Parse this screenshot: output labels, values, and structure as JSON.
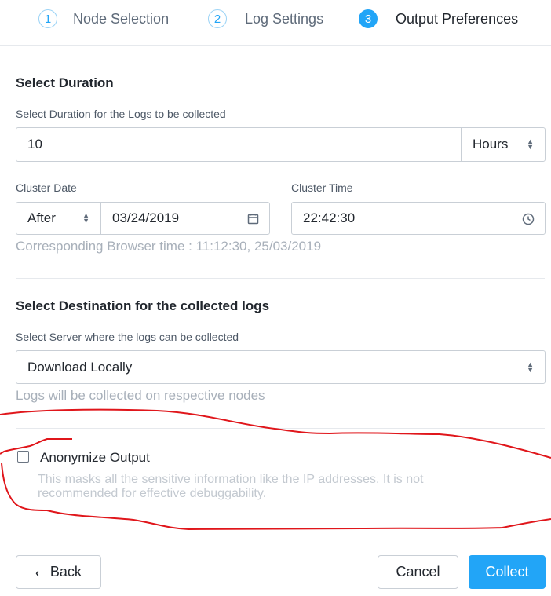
{
  "stepper": {
    "steps": [
      {
        "num": "1",
        "label": "Node Selection"
      },
      {
        "num": "2",
        "label": "Log Settings"
      },
      {
        "num": "3",
        "label": "Output Preferences"
      }
    ],
    "active_step": "3"
  },
  "duration": {
    "heading": "Select Duration",
    "label": "Select Duration for the Logs to be collected",
    "value": "10",
    "unit": "Hours"
  },
  "cluster_date": {
    "label": "Cluster Date",
    "relation": "After",
    "date": "03/24/2019"
  },
  "cluster_time": {
    "label": "Cluster Time",
    "time": "22:42:30"
  },
  "browser_time_note": "Corresponding Browser time : 11:12:30, 25/03/2019",
  "destination": {
    "heading": "Select Destination for the collected logs",
    "label": "Select Server where the logs can be collected",
    "value": "Download Locally",
    "hint": "Logs will be collected on respective nodes"
  },
  "anonymize": {
    "label": "Anonymize Output",
    "checked": false,
    "description_line1": "This masks all the sensitive information like the IP addresses. It is not",
    "description_line2": "recommended for effective debuggability."
  },
  "footer": {
    "back_label": "Back",
    "cancel_label": "Cancel",
    "collect_label": "Collect"
  },
  "colors": {
    "accent": "#22a5f7",
    "annotation": "#e0161b"
  },
  "icons": {
    "back": "chevron-left-icon",
    "date": "calendar-icon",
    "time": "clock-icon",
    "select": "up-down-arrows-icon"
  }
}
